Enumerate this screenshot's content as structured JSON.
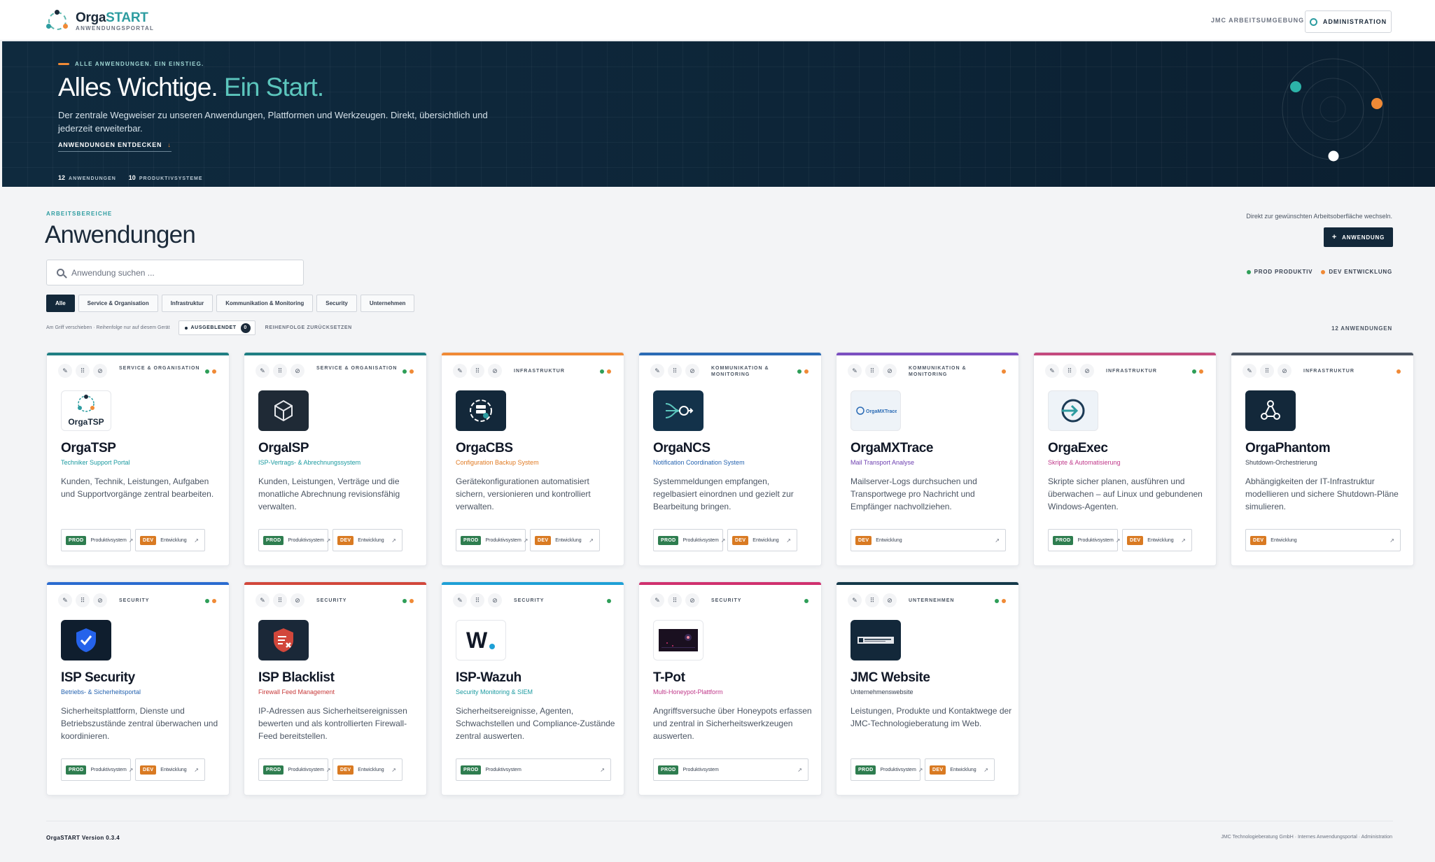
{
  "header": {
    "logo_name": "Orga",
    "logo_accent": "START",
    "logo_sub": "ANWENDUNGSPORTAL",
    "nav_workspace": "JMC ARBEITSUMGEBUNG",
    "admin_label": "ADMINISTRATION"
  },
  "hero": {
    "kicker": "ALLE ANWENDUNGEN. EIN EINSTIEG.",
    "title_main": "Alles Wichtige.",
    "title_accent": "Ein Start.",
    "description": "Der zentrale Wegweiser zu unseren Anwendungen, Plattformen und Werkzeugen. Direkt, übersichtlich und jederzeit erweiterbar.",
    "cta": "ANWENDUNGEN ENTDECKEN",
    "cta_arrow": "↓",
    "stats": [
      {
        "num": "12",
        "label": "ANWENDUNGEN"
      },
      {
        "num": "10",
        "label": "PRODUKTIVSYSTEME"
      }
    ]
  },
  "section": {
    "kicker": "ARBEITSBEREICHE",
    "title": "Anwendungen",
    "hint": "Direkt zur gewünschten Arbeitsoberfläche wechseln.",
    "add_label": "ANWENDUNG",
    "add_plus": "+",
    "legend_prod": "PROD PRODUKTIV",
    "legend_dev": "DEV ENTWICKLUNG",
    "search_placeholder": "Anwendung suchen ...",
    "filters": [
      "Alle",
      "Service & Organisation",
      "Infrastruktur",
      "Kommunikation & Monitoring",
      "Security",
      "Unternehmen"
    ],
    "order_hint": "Am Griff verschieben · Reihenfolge nur auf diesem Gerät",
    "hidden_label": "AUSGEBLENDET",
    "hidden_count": "0",
    "reset_label": "REIHENFOLGE ZURÜCKSETZEN",
    "total": "12 ANWENDUNGEN"
  },
  "colors": {
    "prod": "#2e9e58",
    "dev": "#f08a36",
    "accent": "#2d9ca0",
    "navy": "#13283a"
  },
  "env_labels": {
    "prod_badge": "PROD",
    "dev_badge": "DEV",
    "prod_text": "Produktivsystem",
    "dev_text": "Entwicklung",
    "ext": "↗"
  },
  "cards": [
    {
      "id": "orgatsp",
      "title": "OrgaTSP",
      "subtitle": "Techniker Support Portal",
      "subtitle_color": "#1a9aa0",
      "category": "SERVICE & ORGANISATION",
      "top_color": "#1f7f83",
      "icon": "orgatsp-logo",
      "icon_text": "OrgaTSP",
      "prod": true,
      "dev": true,
      "desc": "Kunden, Technik, Leistungen, Aufgaben und Supportvorgänge zentral bearbeiten."
    },
    {
      "id": "orgaisp",
      "title": "OrgaISP",
      "subtitle": "ISP-Vertrags- & Abrechnungssystem",
      "subtitle_color": "#1a9aa0",
      "category": "SERVICE & ORGANISATION",
      "top_color": "#1f7f83",
      "icon": "cube-icon",
      "prod": true,
      "dev": true,
      "desc": "Kunden, Leistungen, Verträge und die monatliche Abrechnung revisionsfähig verwalten."
    },
    {
      "id": "orgacbs",
      "title": "OrgaCBS",
      "subtitle": "Configuration Backup System",
      "subtitle_color": "#e07a22",
      "category": "INFRASTRUKTUR",
      "top_color": "#f08a36",
      "icon": "server-backup-icon",
      "prod": true,
      "dev": true,
      "desc": "Gerätekonfigurationen automatisiert sichern, versionieren und kontrolliert verwalten."
    },
    {
      "id": "organcs",
      "title": "OrgaNCS",
      "subtitle": "Notification Coordination System",
      "subtitle_color": "#2563b0",
      "category": "KOMMUNIKATION & MONITORING",
      "top_color": "#2a6bb5",
      "icon": "notification-flow-icon",
      "prod": true,
      "dev": true,
      "desc": "Systemmeldungen empfangen, regelbasiert einordnen und gezielt zur Bearbeitung bringen."
    },
    {
      "id": "orgamxtrace",
      "title": "OrgaMXTrace",
      "subtitle": "Mail Transport Analyse",
      "subtitle_color": "#6d3fb0",
      "category": "KOMMUNIKATION & MONITORING",
      "top_color": "#7b4fc0",
      "icon": "orgamxtrace-logo",
      "icon_text": "OrgaMXTrace",
      "prod": false,
      "dev": true,
      "desc": "Mailserver-Logs durchsuchen und Transportwege pro Nachricht und Empfänger nachvollziehen."
    },
    {
      "id": "orgaexec",
      "title": "OrgaExec",
      "subtitle": "Skripte & Automatisierung",
      "subtitle_color": "#c0398a",
      "category": "INFRASTRUKTUR",
      "top_color": "#c44a7e",
      "icon": "execute-icon",
      "prod": true,
      "dev": true,
      "desc": "Skripte sicher planen, ausführen und überwachen – auf Linux und gebundenen Windows-Agenten."
    },
    {
      "id": "orgaphantom",
      "title": "OrgaPhantom",
      "subtitle": "Shutdown-Orchestrierung",
      "subtitle_color": "#374151",
      "category": "INFRASTRUKTUR",
      "top_color": "#4b5563",
      "icon": "network-nodes-icon",
      "prod": false,
      "dev": true,
      "desc": "Abhängigkeiten der IT-Infrastruktur modellieren und sichere Shutdown-Pläne simulieren."
    },
    {
      "id": "ispsecurity",
      "title": "ISP Security",
      "subtitle": "Betriebs- & Sicherheitsportal",
      "subtitle_color": "#2563b0",
      "category": "SECURITY",
      "top_color": "#2a6bd0",
      "icon": "shield-check-icon",
      "prod": true,
      "dev": true,
      "desc": "Sicherheitsplattform, Dienste und Betriebszustände zentral überwachen und koordinieren."
    },
    {
      "id": "ispblacklist",
      "title": "ISP Blacklist",
      "subtitle": "Firewall Feed Management",
      "subtitle_color": "#c73a3a",
      "category": "SECURITY",
      "top_color": "#d2473b",
      "icon": "shield-block-icon",
      "prod": true,
      "dev": true,
      "desc": "IP-Adressen aus Sicherheitsereignissen bewerten und als kontrollierten Firewall-Feed bereitstellen."
    },
    {
      "id": "ispwazuh",
      "title": "ISP-Wazuh",
      "subtitle": "Security Monitoring & SIEM",
      "subtitle_color": "#1a9aa0",
      "category": "SECURITY",
      "top_color": "#1ea0d6",
      "icon": "wazuh-logo",
      "icon_text": "W.",
      "prod": true,
      "dev": false,
      "desc": "Sicherheitsereignisse, Agenten, Schwachstellen und Compliance-Zustände zentral auswerten."
    },
    {
      "id": "tpot",
      "title": "T-Pot",
      "subtitle": "Multi-Honeypot-Plattform",
      "subtitle_color": "#c0398a",
      "category": "SECURITY",
      "top_color": "#d0306e",
      "icon": "tpot-screen-icon",
      "prod": true,
      "dev": false,
      "desc": "Angriffsversuche über Honeypots erfassen und zentral in Sicherheitswerkzeugen auswerten."
    },
    {
      "id": "jmcwebsite",
      "title": "JMC Website",
      "subtitle": "Unternehmenswebsite",
      "subtitle_color": "#374151",
      "category": "UNTERNEHMEN",
      "top_color": "#14394a",
      "icon": "website-icon",
      "prod": true,
      "dev": true,
      "desc": "Leistungen, Produkte und Kontaktwege der JMC-Technologieberatung im Web."
    }
  ],
  "footer": {
    "left": "OrgaSTART Version 0.3.4",
    "right": "JMC Technologieberatung GmbH · Internes Anwendungsportal · Administration"
  }
}
